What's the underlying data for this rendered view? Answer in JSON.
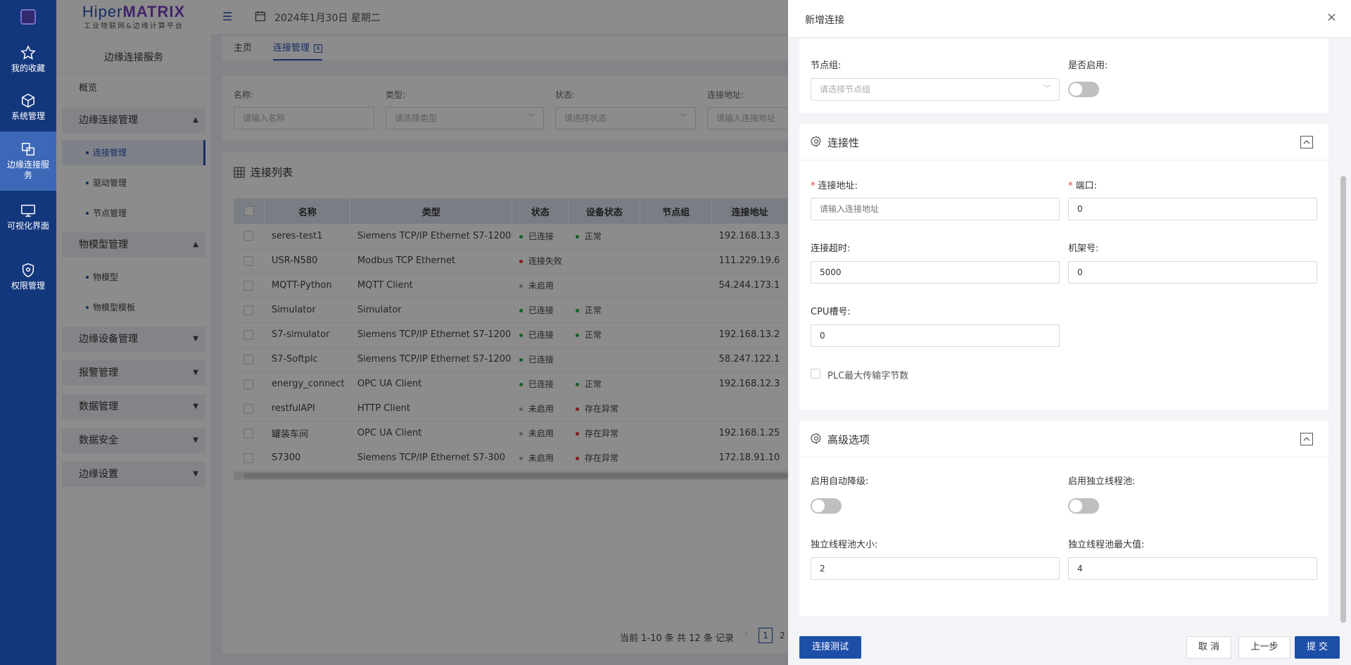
{
  "rail": {
    "items": [
      {
        "label": "我的收藏",
        "icon": "star-icon"
      },
      {
        "label": "系统管理",
        "icon": "cube-icon"
      },
      {
        "label": "边缘连接服务",
        "icon": "link-icon"
      },
      {
        "label": "可视化界面",
        "icon": "screen-icon"
      },
      {
        "label": "权限管理",
        "icon": "shield-icon"
      }
    ]
  },
  "brand": {
    "name_a": "Hiper",
    "name_b": "MATRIX",
    "sub": "工业物联网&边缘计算平台"
  },
  "menu": {
    "title": "边缘连接服务",
    "overview": "概览",
    "groups": [
      {
        "label": "边缘连接管理",
        "subs": [
          "连接管理",
          "驱动管理",
          "节点管理"
        ]
      },
      {
        "label": "物模型管理",
        "subs": [
          "物模型",
          "物模型模板"
        ]
      },
      {
        "label": "边缘设备管理"
      },
      {
        "label": "报警管理"
      },
      {
        "label": "数据管理"
      },
      {
        "label": "数据安全"
      },
      {
        "label": "边缘设置"
      }
    ]
  },
  "topbar": {
    "date": "2024年1月30日 星期二"
  },
  "tabs": {
    "home": "主页",
    "conn": "连接管理",
    "close": "x"
  },
  "filter": {
    "name_label": "名称:",
    "name_ph": "请输入名称",
    "type_label": "类型:",
    "type_ph": "请选择类型",
    "status_label": "状态:",
    "status_ph": "请选择状态",
    "addr_label": "连接地址:",
    "addr_ph": "请输入连接地址"
  },
  "list": {
    "title": "连接列表",
    "headers": [
      "名称",
      "类型",
      "状态",
      "设备状态",
      "节点组",
      "连接地址"
    ],
    "rows": [
      {
        "name": "seres-test1",
        "type": "Siemens TCP/IP Ethernet S7-1200",
        "status": "已连接",
        "sc": "#2eaa4c",
        "dev": "正常",
        "dc": "#2eaa4c",
        "addr": "192.168.13.3"
      },
      {
        "name": "USR-N580",
        "type": "Modbus TCP Ethernet",
        "status": "连接失败",
        "sc": "#e03a3a",
        "dev": "",
        "dc": "",
        "addr": "111.229.19.6"
      },
      {
        "name": "MQTT-Python",
        "type": "MQTT Client",
        "status": "未启用",
        "sc": "#aaaaaa",
        "dev": "",
        "dc": "",
        "addr": "54.244.173.1"
      },
      {
        "name": "Simulator",
        "type": "Simulator",
        "status": "已连接",
        "sc": "#2eaa4c",
        "dev": "正常",
        "dc": "#2eaa4c",
        "addr": ""
      },
      {
        "name": "S7-simulator",
        "type": "Siemens TCP/IP Ethernet S7-1200",
        "status": "已连接",
        "sc": "#2eaa4c",
        "dev": "正常",
        "dc": "#2eaa4c",
        "addr": "192.168.13.2"
      },
      {
        "name": "S7-Softplc",
        "type": "Siemens TCP/IP Ethernet S7-1200",
        "status": "已连接",
        "sc": "#2eaa4c",
        "dev": "",
        "dc": "",
        "addr": "58.247.122.1"
      },
      {
        "name": "energy_connect",
        "type": "OPC UA Client",
        "status": "已连接",
        "sc": "#2eaa4c",
        "dev": "正常",
        "dc": "#2eaa4c",
        "addr": "192.168.12.3"
      },
      {
        "name": "restfulAPI",
        "type": "HTTP Client",
        "status": "未启用",
        "sc": "#aaaaaa",
        "dev": "存在异常",
        "dc": "#e03a3a",
        "addr": ""
      },
      {
        "name": "罐装车间",
        "type": "OPC UA Client",
        "status": "未启用",
        "sc": "#aaaaaa",
        "dev": "存在异常",
        "dc": "#e03a3a",
        "addr": "192.168.1.25"
      },
      {
        "name": "S7300",
        "type": "Siemens TCP/IP Ethernet S7-300",
        "status": "未启用",
        "sc": "#aaaaaa",
        "dev": "存在异常",
        "dc": "#e03a3a",
        "addr": "172.18.91.10"
      }
    ],
    "pager": "当前 1-10 条 共 12 条 记录",
    "page1": "1",
    "page2": "2"
  },
  "drawer": {
    "title": "新增连接",
    "close": "×",
    "node_group_label": "节点组:",
    "node_group_ph": "请选择节点组",
    "enable_label": "是否启用:",
    "conn": {
      "title": "连接性",
      "addr_label": "连接地址:",
      "addr_ph": "请输入连接地址",
      "port_label": "端口:",
      "port_value": "0",
      "timeout_label": "连接超时:",
      "timeout_value": "5000",
      "rack_label": "机架号:",
      "rack_value": "0",
      "slot_label": "CPU槽号:",
      "slot_value": "0",
      "plc_label": "PLC最大传输字节数"
    },
    "adv": {
      "title": "高级选项",
      "auto_label": "启用自动降级:",
      "pool_label": "启用独立线程池:",
      "size_label": "独立线程池大小:",
      "size_value": "2",
      "max_label": "独立线程池最大值:",
      "max_value": "4"
    },
    "buttons": {
      "test": "连接测试",
      "cancel": "取 消",
      "prev": "上一步",
      "submit": "提 交"
    }
  },
  "colors": {
    "rail": "#13377d",
    "primary": "#1e4fa8",
    "ok": "#2eaa4c",
    "err": "#e03a3a"
  }
}
